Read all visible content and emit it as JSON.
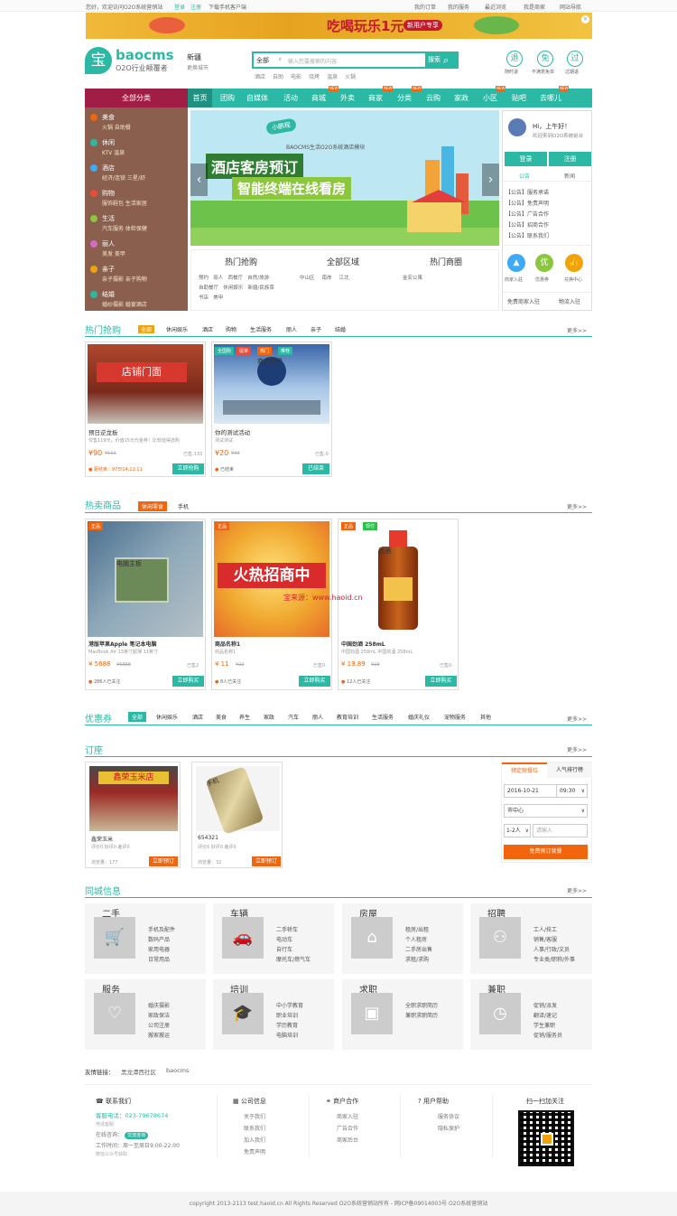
{
  "topbar": {
    "welcome": "您好，欢迎访问O2O系统营销站",
    "login": "登录",
    "register": "注册",
    "download": "下载手机客户端",
    "myorders": "我的订单",
    "myservice": "我的服务",
    "recent": "最近浏览",
    "mybiz": "我是商家",
    "sitenav": "网站导航"
  },
  "banner": {
    "text": "吃喝玩乐1元",
    "sub": "新用户专享"
  },
  "logo": {
    "mark": "宝",
    "name": "baocms",
    "tagline": "O2O行业颠覆者"
  },
  "city": {
    "name": "新疆",
    "switch": "更换城市"
  },
  "search": {
    "category": "全部",
    "placeholder": "输入您要搜索的内容",
    "button": "搜索",
    "hotwords": [
      "酒店",
      "自助",
      "电影",
      "烧烤",
      "温泉",
      "火锅"
    ]
  },
  "top_icons": [
    {
      "glyph": "退",
      "label": "随时退"
    },
    {
      "glyph": "免",
      "label": "不满意免单"
    },
    {
      "glyph": "过",
      "label": "过期退"
    }
  ],
  "nav": {
    "all": "全部分类",
    "items": [
      "首页",
      "团购",
      "自媒体",
      "活动",
      "商城",
      "外卖",
      "商家",
      "分类",
      "云购",
      "家政",
      "小区",
      "贴吧",
      "去哪儿"
    ],
    "hot_label": "NEW"
  },
  "categories": [
    {
      "title": "美食",
      "sub": "火锅 自助餐",
      "color": "#f0650e"
    },
    {
      "title": "休闲",
      "sub": "KTV 温泉",
      "color": "#2bb9a5"
    },
    {
      "title": "酒店",
      "sub": "经济/连锁 三星/舒",
      "color": "#3fa9f5"
    },
    {
      "title": "购物",
      "sub": "服饰鞋包 生活家居",
      "color": "#e74c3c"
    },
    {
      "title": "生活",
      "sub": "汽车服务 体检保健",
      "color": "#8cc63f"
    },
    {
      "title": "丽人",
      "sub": "美发 美甲",
      "color": "#d56ac7"
    },
    {
      "title": "亲子",
      "sub": "亲子摄影 亲子购物",
      "color": "#f0a30a"
    },
    {
      "title": "结婚",
      "sub": "婚纱摄影 婚宴酒店",
      "color": "#2bb9a5"
    }
  ],
  "slider": {
    "badge": "小鹏程",
    "caption": "BAOCMS生活O2O系统酒店模块",
    "title1": "酒店客房预订",
    "title2": "智能终端在线看房"
  },
  "below_slider": {
    "hot_buy": {
      "title": "热门抢购",
      "items": [
        "预约",
        "丽人",
        "西餐厅",
        "自然/旅游",
        "自助餐厅",
        "休闲娱乐",
        "新疆/民族菜",
        "书店",
        "美甲"
      ]
    },
    "area": {
      "title": "全部区域",
      "items": [
        "中山区",
        "南岸",
        "江北"
      ]
    },
    "circle": {
      "title": "热门商圈",
      "items": [
        "金宏公寓"
      ]
    }
  },
  "user_panel": {
    "greeting": "Hi，上午好！",
    "welcome": "欢迎来到O2O系统前台",
    "login": "登录",
    "register": "注册",
    "tabs": [
      "公告",
      "新闻"
    ],
    "notices": [
      "【公告】服务承诺",
      "【公告】免责声明",
      "【公告】广告合作",
      "【公告】招商合作",
      "【公告】联系我们"
    ],
    "quick": [
      {
        "label": "商家入驻",
        "glyph": "▲",
        "color": "#3fa9f5"
      },
      {
        "label": "优惠券",
        "glyph": "优",
        "color": "#8cc63f"
      },
      {
        "label": "兑换中心",
        "glyph": "👍",
        "color": "#f0a30a"
      }
    ],
    "links": [
      "免费商家入驻",
      "物流入驻"
    ]
  },
  "hot_buy": {
    "title": "热门抢购",
    "more": "更多>>",
    "tabs": [
      "全部",
      "休闲娱乐",
      "酒店",
      "购物",
      "生活服务",
      "丽人",
      "亲子",
      "结婚"
    ],
    "products": [
      {
        "name": "预日逆龙板",
        "desc": "仅售119元，价值15元代金券！比较值得选购",
        "price": "¥90",
        "old": "¥111",
        "sold": "已售:133",
        "status": "距结束：97日14:12:11",
        "btn": "立即抢购",
        "img_label": "店铺门面",
        "tags": []
      },
      {
        "name": "你的测试活动",
        "desc": "测试测试",
        "price": "¥20",
        "old": "¥30",
        "sold": "已售:0",
        "status": "已结束",
        "btn": "已结束",
        "img_label": "商务场景",
        "tags": [
          "全国购",
          "促单",
          "热门",
          "推荐"
        ]
      }
    ]
  },
  "hot_sell": {
    "title": "热卖商品",
    "tag": "休闲零食",
    "tab2": "手机",
    "more": "更多>>",
    "products": [
      {
        "name": "港版苹果Apple 笔记本电脑",
        "desc": "MacBook Air 13英寸超薄 11英寸",
        "price": "¥ 5688",
        "old": "¥6888",
        "sold": "已售2",
        "people": "286人已关注",
        "btn": "立即购买",
        "tags": [
          "正品"
        ],
        "img_label": "电脑主板"
      },
      {
        "name": "商品名称1",
        "desc": "商品名称1",
        "price": "¥ 11",
        "old": "¥22",
        "sold": "已售0",
        "people": "8人已关注",
        "btn": "立即购买",
        "tags": [
          "正品"
        ],
        "img_label": "火热招商中"
      },
      {
        "name": "中国劲酒 258mL",
        "desc": "中国劲酒 258mL 中国劲酒 258mL",
        "price": "¥ 19.89",
        "old": "¥23",
        "sold": "已售0",
        "people": "12人已关注",
        "btn": "立即购买",
        "tags": [
          "正品",
          "现付"
        ],
        "img_label": "劲酒"
      }
    ]
  },
  "coupon": {
    "title": "优惠券",
    "more": "更多>>",
    "tabs": [
      "全部",
      "休闲娱乐",
      "酒店",
      "美食",
      "养生",
      "家政",
      "汽车",
      "丽人",
      "教育培训",
      "生活服务",
      "婚庆礼仪",
      "宠物服务",
      "其他"
    ]
  },
  "booking": {
    "title": "订座",
    "more": "更多>>",
    "items": [
      {
        "name": "鑫荣玉米",
        "sub": "评价0 好评0 差评0",
        "views": "浏览量：177",
        "btn": "立即预订",
        "img_label": "鑫荣玉米店"
      },
      {
        "name": "654321",
        "sub": "评价0 好评0 差评0",
        "views": "浏览量：32",
        "btn": "立即预订",
        "img_label": "手机"
      }
    ],
    "form": {
      "tabs": [
        "预定就餐位",
        "人气排行榜"
      ],
      "date": "2016-10-21",
      "time": "09:30",
      "area": "市中心",
      "people": "1-2人",
      "placeholder": "请输入",
      "submit": "免费预订就餐"
    }
  },
  "classified": {
    "title": "同城信息",
    "more": "更多>>",
    "boxes": [
      {
        "title": "二手",
        "glyph": "🛒",
        "items": [
          "手机及配件",
          "数码产品",
          "家用电器",
          "日常用品"
        ]
      },
      {
        "title": "车辆",
        "glyph": "🚗",
        "items": [
          "二手轿车",
          "电动车",
          "自行车",
          "摩托车/燃气车"
        ]
      },
      {
        "title": "房屋",
        "glyph": "⌂",
        "items": [
          "租房/出租",
          "个人租房",
          "二手房出售",
          "求租/求购"
        ]
      },
      {
        "title": "招聘",
        "glyph": "⚇",
        "items": [
          "工人/技工",
          "销售/客服",
          "人事/行政/文员",
          "专业类/职称/外事"
        ]
      },
      {
        "title": "服务",
        "glyph": "♡",
        "items": [
          "婚庆摄影",
          "家政保洁",
          "公司注册",
          "搬家搬运"
        ]
      },
      {
        "title": "培训",
        "glyph": "🎓",
        "items": [
          "中小学教育",
          "职业培训",
          "学历教育",
          "电脑培训"
        ]
      },
      {
        "title": "求职",
        "glyph": "▣",
        "items": [
          "全职求职简历",
          "兼职求职简历"
        ]
      },
      {
        "title": "兼职",
        "glyph": "◷",
        "items": [
          "促销/派发",
          "翻译/速记",
          "学生兼职",
          "促销/服务员"
        ]
      }
    ]
  },
  "friend_links": {
    "label": "友情链接：",
    "items": [
      "黑龙潭西社区",
      "baocms"
    ]
  },
  "footer_cols": [
    {
      "title": "联系我们",
      "lines": [
        "客服电话：023-79678674",
        "电话客服",
        "在线咨询：",
        "工作时间：周一至周日9:00-22:00",
        "微信公众号获取"
      ]
    },
    {
      "title": "公司信息",
      "lines": [
        "关于我们",
        "联系我们",
        "加入我们",
        "免责声明"
      ]
    },
    {
      "title": "商户合作",
      "lines": [
        "商家入驻",
        "广告合作",
        "商家后台"
      ]
    },
    {
      "title": "用户帮助",
      "lines": [
        "服务协议",
        "隐私保护"
      ]
    }
  ],
  "qr": {
    "title": "扫一扫加关注"
  },
  "online_btn": "交流咨询",
  "footer": {
    "copyright": "copyright 2013-2113 test.haoid.cn All Rights Reserved O2O系统营销站所有 - 网ICP备09014003号 O2O系统营销站"
  },
  "watermark": "宝来源：www.haoid.cn"
}
